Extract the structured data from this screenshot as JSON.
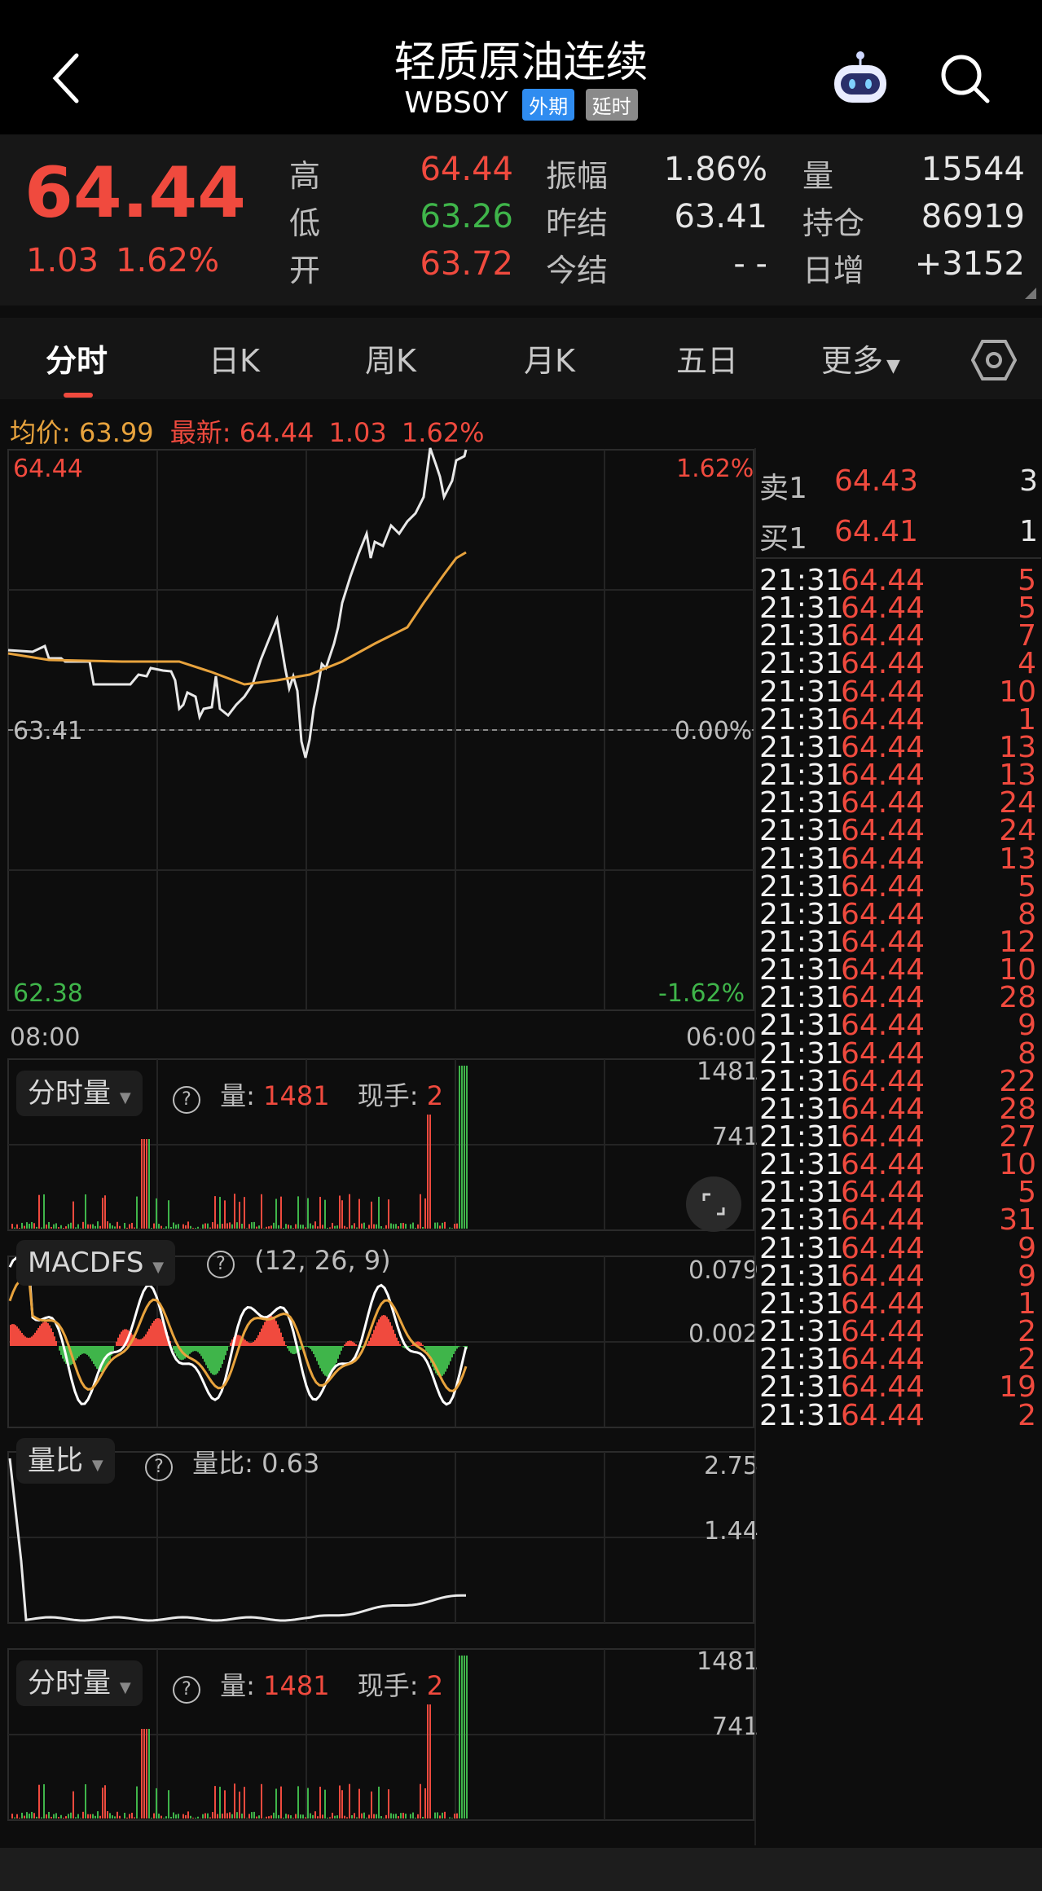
{
  "header": {
    "title": "轻质原油连续",
    "code": "WBS0Y",
    "tag_foreign": "外期",
    "tag_delay": "延时"
  },
  "quote": {
    "price": "64.44",
    "change": "1.03",
    "change_pct": "1.62%",
    "high_label": "高",
    "high": "64.44",
    "low_label": "低",
    "low": "63.26",
    "open_label": "开",
    "open": "63.72",
    "amp_label": "振幅",
    "amp": "1.86%",
    "prev_label": "昨结",
    "prev": "63.41",
    "settle_label": "今结",
    "settle": "- -",
    "vol_label": "量",
    "vol": "15544",
    "oi_label": "持仓",
    "oi": "86919",
    "daily_label": "日增",
    "daily": "+3152"
  },
  "tabs": [
    "分时",
    "日K",
    "周K",
    "月K",
    "五日",
    "更多"
  ],
  "info_line": {
    "avg_label": "均价:",
    "avg": "63.99",
    "latest_label": "最新:",
    "latest": "64.44",
    "chg": "1.03",
    "pct": "1.62%"
  },
  "main_chart": {
    "y_top": "64.44",
    "y_mid": "63.41",
    "y_bottom": "62.38",
    "pct_top": "1.62%",
    "pct_mid": "0.00%",
    "pct_bottom": "-1.62%",
    "t_start": "08:00",
    "t_end": "06:00"
  },
  "vol_panel_1": {
    "name": "分时量",
    "help": "?",
    "vol_label": "量:",
    "vol": "1481",
    "hand_label": "现手:",
    "hand": "2",
    "max": "1481",
    "mid": "741"
  },
  "macd_panel": {
    "name": "MACDFS",
    "help": "?",
    "params": "(12, 26, 9)",
    "top": "0.079",
    "mid": "0.002"
  },
  "ratio_panel": {
    "name": "量比",
    "help": "?",
    "label": "量比:",
    "value": "0.63",
    "top": "2.75",
    "mid": "1.44"
  },
  "vol_panel_2": {
    "name": "分时量",
    "help": "?",
    "vol_label": "量:",
    "vol": "1481",
    "hand_label": "现手:",
    "hand": "2",
    "max": "1481",
    "mid": "741"
  },
  "order_book": {
    "sell_label": "卖1",
    "sell_price": "64.43",
    "sell_qty": "3",
    "buy_label": "买1",
    "buy_price": "64.41",
    "buy_qty": "1"
  },
  "ticks": [
    {
      "t": "21:31",
      "p": "64.44",
      "q": "5"
    },
    {
      "t": "21:31",
      "p": "64.44",
      "q": "5"
    },
    {
      "t": "21:31",
      "p": "64.44",
      "q": "7"
    },
    {
      "t": "21:31",
      "p": "64.44",
      "q": "4"
    },
    {
      "t": "21:31",
      "p": "64.44",
      "q": "10"
    },
    {
      "t": "21:31",
      "p": "64.44",
      "q": "1"
    },
    {
      "t": "21:31",
      "p": "64.44",
      "q": "13"
    },
    {
      "t": "21:31",
      "p": "64.44",
      "q": "13"
    },
    {
      "t": "21:31",
      "p": "64.44",
      "q": "24"
    },
    {
      "t": "21:31",
      "p": "64.44",
      "q": "24"
    },
    {
      "t": "21:31",
      "p": "64.44",
      "q": "13"
    },
    {
      "t": "21:31",
      "p": "64.44",
      "q": "5"
    },
    {
      "t": "21:31",
      "p": "64.44",
      "q": "8"
    },
    {
      "t": "21:31",
      "p": "64.44",
      "q": "12"
    },
    {
      "t": "21:31",
      "p": "64.44",
      "q": "10"
    },
    {
      "t": "21:31",
      "p": "64.44",
      "q": "28"
    },
    {
      "t": "21:31",
      "p": "64.44",
      "q": "9"
    },
    {
      "t": "21:31",
      "p": "64.44",
      "q": "8"
    },
    {
      "t": "21:31",
      "p": "64.44",
      "q": "22"
    },
    {
      "t": "21:31",
      "p": "64.44",
      "q": "28"
    },
    {
      "t": "21:31",
      "p": "64.44",
      "q": "27"
    },
    {
      "t": "21:31",
      "p": "64.44",
      "q": "10"
    },
    {
      "t": "21:31",
      "p": "64.44",
      "q": "5"
    },
    {
      "t": "21:31",
      "p": "64.44",
      "q": "31"
    },
    {
      "t": "21:31",
      "p": "64.44",
      "q": "9"
    },
    {
      "t": "21:31",
      "p": "64.44",
      "q": "9"
    },
    {
      "t": "21:31",
      "p": "64.44",
      "q": "1"
    },
    {
      "t": "21:31",
      "p": "64.44",
      "q": "2"
    },
    {
      "t": "21:31",
      "p": "64.44",
      "q": "2"
    },
    {
      "t": "21:31",
      "p": "64.44",
      "q": "19"
    },
    {
      "t": "21:31",
      "p": "64.44",
      "q": "2"
    }
  ],
  "colors": {
    "up": "#f04a3e",
    "down": "#3fb54a",
    "avg_line": "#e8a33d",
    "price_line": "#e8e8e8",
    "bg": "#0d0d0d"
  }
}
